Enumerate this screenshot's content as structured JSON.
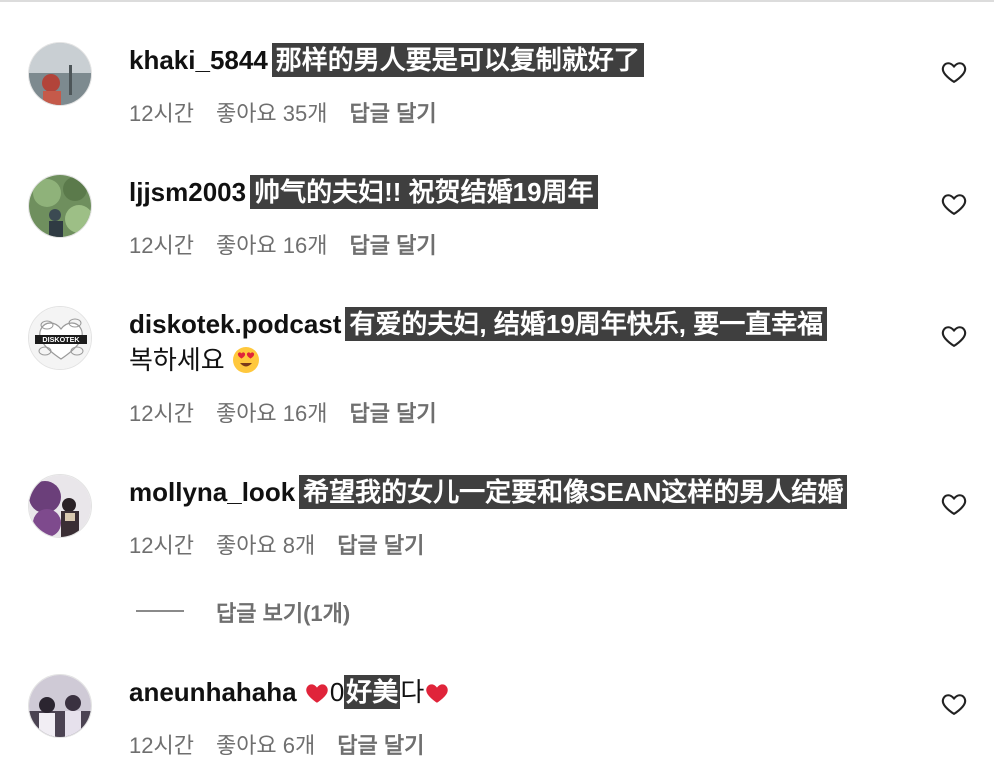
{
  "comments": [
    {
      "username": "khaki_5844",
      "segments": [
        "那样的男人要是可以复制就好了"
      ],
      "time": "12시간",
      "likes": "좋아요 35개",
      "reply": "답글 달기"
    },
    {
      "username": "ljjsm2003",
      "segments": [
        "帅气的夫妇!! 祝贺结婚19周年"
      ],
      "time": "12시간",
      "likes": "좋아요 16개",
      "reply": "답글 달기"
    },
    {
      "username": "diskotek.podcast",
      "segments": [
        "有爱的夫妇, 结婚19周年快乐, 要一直幸福"
      ],
      "line2_text": "복하세요",
      "avatar_text": "DISKOTEK",
      "time": "12시간",
      "likes": "좋아요 16개",
      "reply": "답글 달기"
    },
    {
      "username": "mollyna_look",
      "segments": [
        "希望我的女儿一定要和像SEAN这样的男人结婚"
      ],
      "time": "12시간",
      "likes": "좋아요 8개",
      "reply": "답글 달기"
    },
    {
      "username": "aneunhahaha",
      "text_pre": "0",
      "segments": [
        "好美"
      ],
      "text_post": "다",
      "time": "12시간",
      "likes": "좋아요 6개",
      "reply": "답글 달기"
    }
  ],
  "view_replies": "답글 보기(1개)",
  "icons": {
    "like": "heart-outline-icon",
    "red_heart": "red-heart-emoji",
    "heart_eyes": "heart-eyes-emoji"
  },
  "colors": {
    "highlight_bg": "#3f3f3f",
    "meta_text": "#6f6f6f",
    "red_heart": "#e0243a",
    "emoji_face": "#ffc83d"
  }
}
